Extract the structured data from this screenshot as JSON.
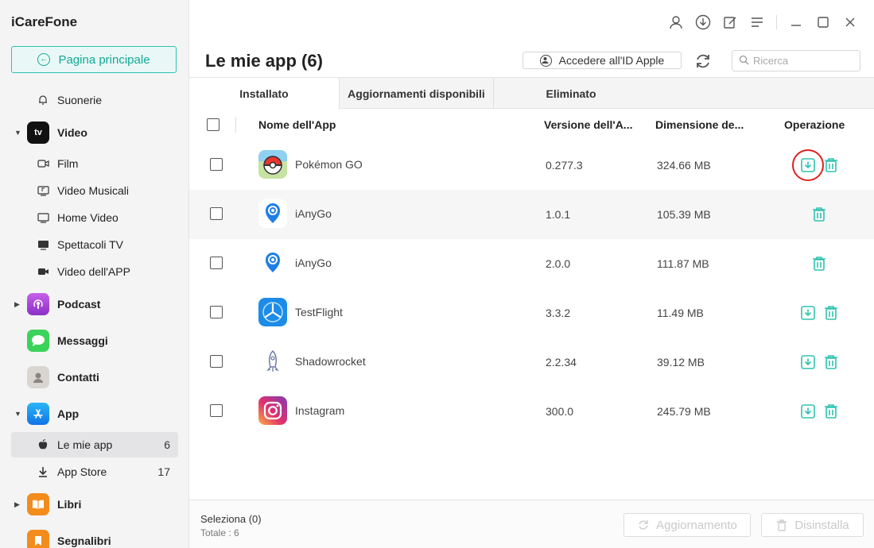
{
  "app": {
    "title": "iCareFone",
    "home_label": "Pagina principale"
  },
  "sidebar": {
    "ringtones": "Suonerie",
    "video": {
      "label": "Video",
      "icon_text": "tv",
      "items": [
        "Film",
        "Video Musicali",
        "Home Video",
        "Spettacoli TV",
        "Video dell'APP"
      ]
    },
    "podcast": "Podcast",
    "messages": "Messaggi",
    "contacts": "Contatti",
    "app": {
      "label": "App",
      "items": [
        {
          "label": "Le mie app",
          "count": "6"
        },
        {
          "label": "App Store",
          "count": "17"
        }
      ]
    },
    "books": "Libri",
    "bookmarks": "Segnalibri"
  },
  "header": {
    "title": "Le mie app (6)",
    "apple_id_button": "Accedere all'ID Apple",
    "search_placeholder": "Ricerca"
  },
  "tabs": [
    "Installato",
    "Aggiornamenti disponibili",
    "Eliminato"
  ],
  "table": {
    "columns": [
      "Nome dell'App",
      "Versione dell'A...",
      "Dimensione de...",
      "Operazione"
    ],
    "rows": [
      {
        "name": "Pokémon GO",
        "version": "0.277.3",
        "size": "324.66 MB"
      },
      {
        "name": "iAnyGo",
        "version": "1.0.1",
        "size": "105.39 MB"
      },
      {
        "name": "iAnyGo",
        "version": "2.0.0",
        "size": "111.87 MB"
      },
      {
        "name": "TestFlight",
        "version": "3.3.2",
        "size": "11.49 MB"
      },
      {
        "name": "Shadowrocket",
        "version": "2.2.34",
        "size": "39.12 MB"
      },
      {
        "name": "Instagram",
        "version": "300.0",
        "size": "245.79 MB"
      }
    ]
  },
  "footer": {
    "selection": "Seleziona (0)",
    "total": "Totale : 6",
    "update_button": "Aggiornamento",
    "uninstall_button": "Disinstalla"
  },
  "colors": {
    "accent": "#2fc3b1",
    "highlight_ring": "#dd2222"
  }
}
